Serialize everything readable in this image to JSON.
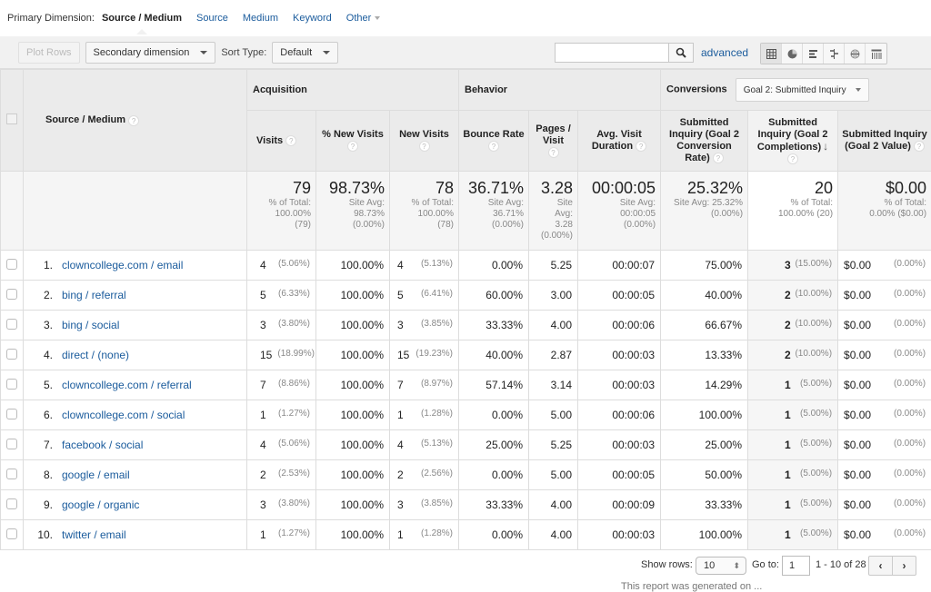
{
  "primary_dimension": {
    "label": "Primary Dimension:",
    "active": "Source / Medium",
    "options": [
      "Source",
      "Medium",
      "Keyword"
    ],
    "other_label": "Other"
  },
  "toolbar": {
    "plot_rows": "Plot Rows",
    "secondary_dimension": "Secondary dimension",
    "sort_type_label": "Sort Type:",
    "sort_type_value": "Default",
    "search_value": "",
    "advanced": "advanced",
    "view_icons": [
      "table-view-icon",
      "pie-view-icon",
      "bar-view-icon",
      "comparison-view-icon",
      "term-cloud-view-icon",
      "pivot-view-icon"
    ]
  },
  "table": {
    "dimension_header": "Source / Medium",
    "groups": {
      "acquisition": "Acquisition",
      "behavior": "Behavior",
      "conversions": "Conversions",
      "goal_select": "Goal 2: Submitted Inquiry"
    },
    "columns": [
      "Visits",
      "% New Visits",
      "New Visits",
      "Bounce Rate",
      "Pages / Visit",
      "Avg. Visit Duration",
      "Submitted Inquiry (Goal 2 Conversion Rate)",
      "Submitted Inquiry (Goal 2 Completions)",
      "Submitted Inquiry (Goal 2 Value)"
    ],
    "totals": [
      {
        "main": "79",
        "sub": [
          "% of Total:",
          "100.00%",
          "(79)"
        ]
      },
      {
        "main": "98.73%",
        "sub": [
          "Site Avg:",
          "98.73%",
          "(0.00%)"
        ]
      },
      {
        "main": "78",
        "sub": [
          "% of Total:",
          "100.00%",
          "(78)"
        ]
      },
      {
        "main": "36.71%",
        "sub": [
          "Site Avg:",
          "36.71%",
          "(0.00%)"
        ]
      },
      {
        "main": "3.28",
        "sub": [
          "Site",
          "Avg:",
          "3.28",
          "(0.00%)"
        ]
      },
      {
        "main": "00:00:05",
        "sub": [
          "Site Avg:",
          "00:00:05",
          "(0.00%)"
        ]
      },
      {
        "main": "25.32%",
        "sub": [
          "Site Avg: 25.32%",
          "(0.00%)"
        ]
      },
      {
        "main": "20",
        "sub": [
          "% of Total:",
          "100.00% (20)"
        ]
      },
      {
        "main": "$0.00",
        "sub": [
          "% of Total:",
          "0.00% ($0.00)"
        ]
      }
    ],
    "rows": [
      {
        "rank": "1.",
        "dim": "clowncollege.com / email",
        "visits": "4",
        "visits_pct": "(5.06%)",
        "pct_new": "100.00%",
        "new_visits": "4",
        "new_pct": "(5.13%)",
        "bounce": "0.00%",
        "ppv": "5.25",
        "dur": "00:00:07",
        "conv_rate": "75.00%",
        "completions": "3",
        "comp_pct": "(15.00%)",
        "value": "$0.00",
        "value_pct": "(0.00%)"
      },
      {
        "rank": "2.",
        "dim": "bing / referral",
        "visits": "5",
        "visits_pct": "(6.33%)",
        "pct_new": "100.00%",
        "new_visits": "5",
        "new_pct": "(6.41%)",
        "bounce": "60.00%",
        "ppv": "3.00",
        "dur": "00:00:05",
        "conv_rate": "40.00%",
        "completions": "2",
        "comp_pct": "(10.00%)",
        "value": "$0.00",
        "value_pct": "(0.00%)"
      },
      {
        "rank": "3.",
        "dim": "bing / social",
        "visits": "3",
        "visits_pct": "(3.80%)",
        "pct_new": "100.00%",
        "new_visits": "3",
        "new_pct": "(3.85%)",
        "bounce": "33.33%",
        "ppv": "4.00",
        "dur": "00:00:06",
        "conv_rate": "66.67%",
        "completions": "2",
        "comp_pct": "(10.00%)",
        "value": "$0.00",
        "value_pct": "(0.00%)"
      },
      {
        "rank": "4.",
        "dim": "direct / (none)",
        "visits": "15",
        "visits_pct": "(18.99%)",
        "pct_new": "100.00%",
        "new_visits": "15",
        "new_pct": "(19.23%)",
        "bounce": "40.00%",
        "ppv": "2.87",
        "dur": "00:00:03",
        "conv_rate": "13.33%",
        "completions": "2",
        "comp_pct": "(10.00%)",
        "value": "$0.00",
        "value_pct": "(0.00%)"
      },
      {
        "rank": "5.",
        "dim": "clowncollege.com / referral",
        "visits": "7",
        "visits_pct": "(8.86%)",
        "pct_new": "100.00%",
        "new_visits": "7",
        "new_pct": "(8.97%)",
        "bounce": "57.14%",
        "ppv": "3.14",
        "dur": "00:00:03",
        "conv_rate": "14.29%",
        "completions": "1",
        "comp_pct": "(5.00%)",
        "value": "$0.00",
        "value_pct": "(0.00%)"
      },
      {
        "rank": "6.",
        "dim": "clowncollege.com / social",
        "visits": "1",
        "visits_pct": "(1.27%)",
        "pct_new": "100.00%",
        "new_visits": "1",
        "new_pct": "(1.28%)",
        "bounce": "0.00%",
        "ppv": "5.00",
        "dur": "00:00:06",
        "conv_rate": "100.00%",
        "completions": "1",
        "comp_pct": "(5.00%)",
        "value": "$0.00",
        "value_pct": "(0.00%)"
      },
      {
        "rank": "7.",
        "dim": "facebook / social",
        "visits": "4",
        "visits_pct": "(5.06%)",
        "pct_new": "100.00%",
        "new_visits": "4",
        "new_pct": "(5.13%)",
        "bounce": "25.00%",
        "ppv": "5.25",
        "dur": "00:00:03",
        "conv_rate": "25.00%",
        "completions": "1",
        "comp_pct": "(5.00%)",
        "value": "$0.00",
        "value_pct": "(0.00%)"
      },
      {
        "rank": "8.",
        "dim": "google / email",
        "visits": "2",
        "visits_pct": "(2.53%)",
        "pct_new": "100.00%",
        "new_visits": "2",
        "new_pct": "(2.56%)",
        "bounce": "0.00%",
        "ppv": "5.00",
        "dur": "00:00:05",
        "conv_rate": "50.00%",
        "completions": "1",
        "comp_pct": "(5.00%)",
        "value": "$0.00",
        "value_pct": "(0.00%)"
      },
      {
        "rank": "9.",
        "dim": "google / organic",
        "visits": "3",
        "visits_pct": "(3.80%)",
        "pct_new": "100.00%",
        "new_visits": "3",
        "new_pct": "(3.85%)",
        "bounce": "33.33%",
        "ppv": "4.00",
        "dur": "00:00:09",
        "conv_rate": "33.33%",
        "completions": "1",
        "comp_pct": "(5.00%)",
        "value": "$0.00",
        "value_pct": "(0.00%)"
      },
      {
        "rank": "10.",
        "dim": "twitter / email",
        "visits": "1",
        "visits_pct": "(1.27%)",
        "pct_new": "100.00%",
        "new_visits": "1",
        "new_pct": "(1.28%)",
        "bounce": "0.00%",
        "ppv": "4.00",
        "dur": "00:00:03",
        "conv_rate": "100.00%",
        "completions": "1",
        "comp_pct": "(5.00%)",
        "value": "$0.00",
        "value_pct": "(0.00%)"
      }
    ]
  },
  "pagination": {
    "show_rows_label": "Show rows:",
    "show_rows_value": "10",
    "goto_label": "Go to:",
    "goto_value": "1",
    "range": "1 - 10 of 28",
    "prev": "‹",
    "next": "›"
  },
  "footer_note": "This report was generated on ..."
}
